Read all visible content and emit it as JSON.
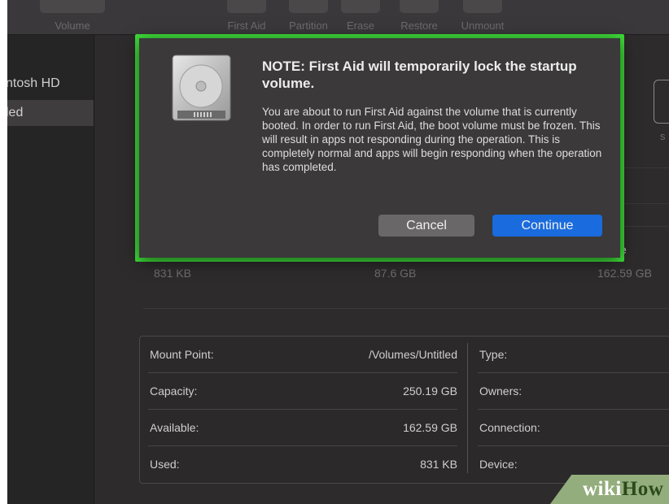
{
  "toolbar": {
    "volume_label": "Volume",
    "buttons": [
      {
        "label": "First Aid",
        "icon": "stethoscope-icon"
      },
      {
        "label": "Partition",
        "icon": "pie-icon"
      },
      {
        "label": "Erase",
        "icon": "erase-icon"
      },
      {
        "label": "Restore",
        "icon": "restore-icon"
      },
      {
        "label": "Unmount",
        "icon": "eject-icon"
      }
    ]
  },
  "sidebar": {
    "items": [
      {
        "label": "ntosh HD"
      },
      {
        "label": "led"
      }
    ]
  },
  "main": {
    "stats": {
      "used": "831 KB",
      "other": "87.6 GB",
      "free": "162.59 GB",
      "free_suffix": "e"
    },
    "ghost_right_letter": "s"
  },
  "info": {
    "left": [
      {
        "label": "Mount Point:",
        "value": "/Volumes/Untitled"
      },
      {
        "label": "Capacity:",
        "value": "250.19 GB"
      },
      {
        "label": "Available:",
        "value": "162.59 GB"
      },
      {
        "label": "Used:",
        "value": "831 KB"
      }
    ],
    "right": [
      {
        "label": "Type:"
      },
      {
        "label": "Owners:"
      },
      {
        "label": "Connection:"
      },
      {
        "label": "Device:"
      }
    ]
  },
  "dialog": {
    "title": "NOTE: First Aid will temporarily lock the startup volume.",
    "body": "You are about to run First Aid against the volume that is currently booted. In order to run First Aid, the boot volume must be frozen. This will result in apps not responding during the operation. This is completely normal and apps will begin responding when the operation has completed.",
    "cancel_label": "Cancel",
    "continue_label": "Continue",
    "icon": "hard-drive-icon",
    "highlight_color": "#3fe03a",
    "accent_color": "#1a6bde"
  },
  "watermark": {
    "wiki": "wiki",
    "how": "How"
  }
}
